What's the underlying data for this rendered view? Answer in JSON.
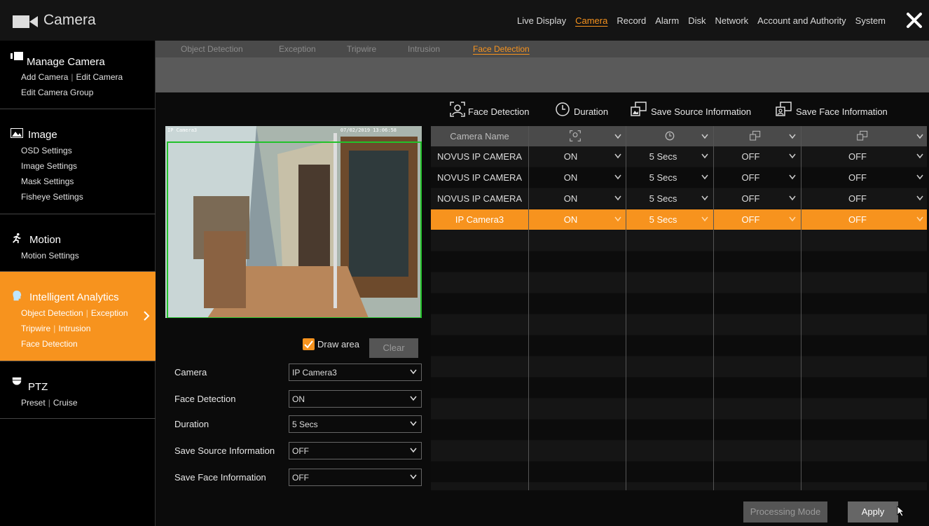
{
  "window": {
    "title": "Camera"
  },
  "topnav": {
    "items": [
      "Live Display",
      "Camera",
      "Record",
      "Alarm",
      "Disk",
      "Network",
      "Account and Authority",
      "System"
    ],
    "active": "Camera"
  },
  "sidebar": {
    "manage": {
      "title": "Manage Camera",
      "row1": [
        "Add Camera",
        "Edit Camera"
      ],
      "row2": "Edit Camera Group"
    },
    "image": {
      "title": "Image",
      "items": [
        "OSD Settings",
        "Image Settings",
        "Mask Settings",
        "Fisheye Settings"
      ]
    },
    "motion": {
      "title": "Motion",
      "items": [
        "Motion Settings"
      ]
    },
    "analytics": {
      "title": "Intelligent Analytics",
      "row1": [
        "Object Detection",
        "Exception"
      ],
      "row2": [
        "Tripwire",
        "Intrusion"
      ],
      "row3": "Face Detection"
    },
    "ptz": {
      "title": "PTZ",
      "row1": [
        "Preset",
        "Cruise"
      ]
    }
  },
  "tabs": {
    "items": [
      "Object Detection",
      "Exception",
      "Tripwire",
      "Intrusion",
      "Face Detection"
    ],
    "active": "Face Detection"
  },
  "preview": {
    "label": "IP Camera3",
    "timestamp": "07/02/2019 13:06:58"
  },
  "draw_area": {
    "label": "Draw area",
    "checked": true,
    "clear_label": "Clear"
  },
  "form": {
    "camera": {
      "label": "Camera",
      "value": "IP Camera3"
    },
    "face_detection": {
      "label": "Face Detection",
      "value": "ON"
    },
    "duration": {
      "label": "Duration",
      "value": "5 Secs"
    },
    "save_source": {
      "label": "Save Source Information",
      "value": "OFF"
    },
    "save_face": {
      "label": "Save Face Information",
      "value": "OFF"
    }
  },
  "legend": {
    "face_detection": "Face Detection",
    "duration": "Duration",
    "save_source": "Save Source Information",
    "save_face": "Save Face Information"
  },
  "table": {
    "header_camera": "Camera Name",
    "rows": [
      {
        "camera": "NOVUS IP CAMERA",
        "face": "ON",
        "duration": "5 Secs",
        "source": "OFF",
        "faceinfo": "OFF"
      },
      {
        "camera": "NOVUS IP CAMERA",
        "face": "ON",
        "duration": "5 Secs",
        "source": "OFF",
        "faceinfo": "OFF"
      },
      {
        "camera": "NOVUS IP CAMERA",
        "face": "ON",
        "duration": "5 Secs",
        "source": "OFF",
        "faceinfo": "OFF"
      },
      {
        "camera": "IP Camera3",
        "face": "ON",
        "duration": "5 Secs",
        "source": "OFF",
        "faceinfo": "OFF"
      }
    ],
    "selected_row": 3
  },
  "buttons": {
    "processing_mode": "Processing Mode",
    "apply": "Apply"
  },
  "colors": {
    "accent": "#f7931e",
    "draw_rect": "#22c22a"
  }
}
